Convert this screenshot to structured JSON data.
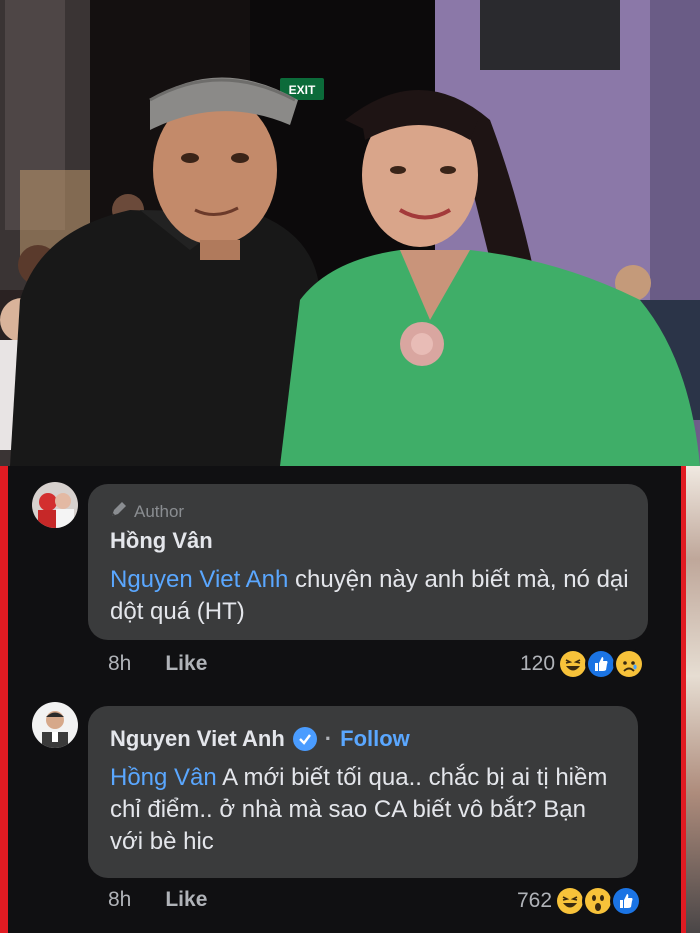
{
  "photo": {
    "exit_sign": "EXIT"
  },
  "comments": [
    {
      "author_badge": "Author",
      "name": "Hồng Vân",
      "mention": "Nguyen Viet Anh",
      "text": " chuyện này anh biết mà, nó dại dột quá (HT)",
      "time": "8h",
      "like_label": "Like",
      "reaction_count": "120",
      "reactions": [
        "haha-icon",
        "like-icon",
        "sad-icon"
      ]
    },
    {
      "name": "Nguyen Viet Anh",
      "verified": true,
      "separator": "·",
      "follow_label": "Follow",
      "mention": "Hồng Vân",
      "text": " A mới biết tối qua.. chắc bị ai tị hiềm chỉ điểm.. ở nhà mà sao CA biết vô bắt? Bạn với bè hic",
      "time": "8h",
      "like_label": "Like",
      "reaction_count": "762",
      "reactions": [
        "haha-icon",
        "wow-icon",
        "like-icon"
      ]
    }
  ],
  "colors": {
    "background": "#101012",
    "bubble": "#3a3b3c",
    "mention": "#5aa7ff",
    "frame": "#e01b22"
  }
}
